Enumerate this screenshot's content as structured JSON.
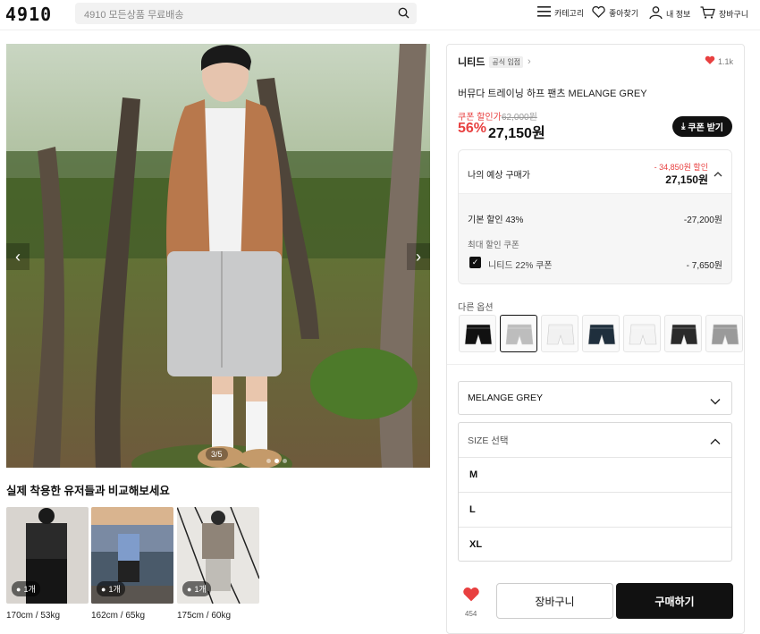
{
  "header": {
    "logo": "4910",
    "search_placeholder": "4910 모든상품 무료배송",
    "nav": [
      {
        "label": "카테고리",
        "icon": "menu-icon"
      },
      {
        "label": "좋아찾기",
        "icon": "heart-icon"
      },
      {
        "label": "내 정보",
        "icon": "user-icon"
      },
      {
        "label": "장바구니",
        "icon": "cart-icon"
      }
    ]
  },
  "gallery": {
    "counter": "3/5",
    "prev_icon": "chevron-left-icon",
    "next_icon": "chevron-right-icon"
  },
  "reviews": {
    "title": "실제 착용한 유저들과 비교해보세요",
    "items": [
      {
        "badge": "1개",
        "caption": "170cm / 53kg"
      },
      {
        "badge": "1개",
        "caption": "162cm / 65kg"
      },
      {
        "badge": "1개",
        "caption": "175cm / 60kg"
      }
    ]
  },
  "product": {
    "brand": "니티드",
    "brand_tag": "공식 입점",
    "likes_top": "1.1k",
    "name": "버뮤다 트레이닝 하프 팬츠 MELANGE GREY",
    "coupon_label": "쿠폰 할인가",
    "original_price": "62,000원",
    "discount_pct": "56%",
    "price": "27,150원",
    "coupon_button": "쿠폰 받기"
  },
  "estimate": {
    "label": "나의 예상 구매가",
    "discount_note": "- 34,850원 할인",
    "price": "27,150원",
    "base_label": "기본 할인 43%",
    "base_value": "-27,200원",
    "coupon_section": "최대 할인 쿠폰",
    "coupon_name": "니티드 22% 쿠폰",
    "coupon_value": "- 7,650원"
  },
  "options": {
    "other_label": "다른 옵션",
    "colors": [
      "#111111",
      "#bdbdbd",
      "#f1f1f1",
      "#1f2f3d",
      "#f4f4f4",
      "#2a2a2a",
      "#9a9a9a"
    ],
    "selected_color": "MELANGE GREY",
    "size_placeholder": "SIZE 선택",
    "sizes": [
      "M",
      "L",
      "XL"
    ]
  },
  "actions": {
    "wish_count": "454",
    "cart": "장바구니",
    "buy": "구매하기"
  },
  "colors": {
    "accent_red": "#e84040",
    "dark": "#111111"
  }
}
